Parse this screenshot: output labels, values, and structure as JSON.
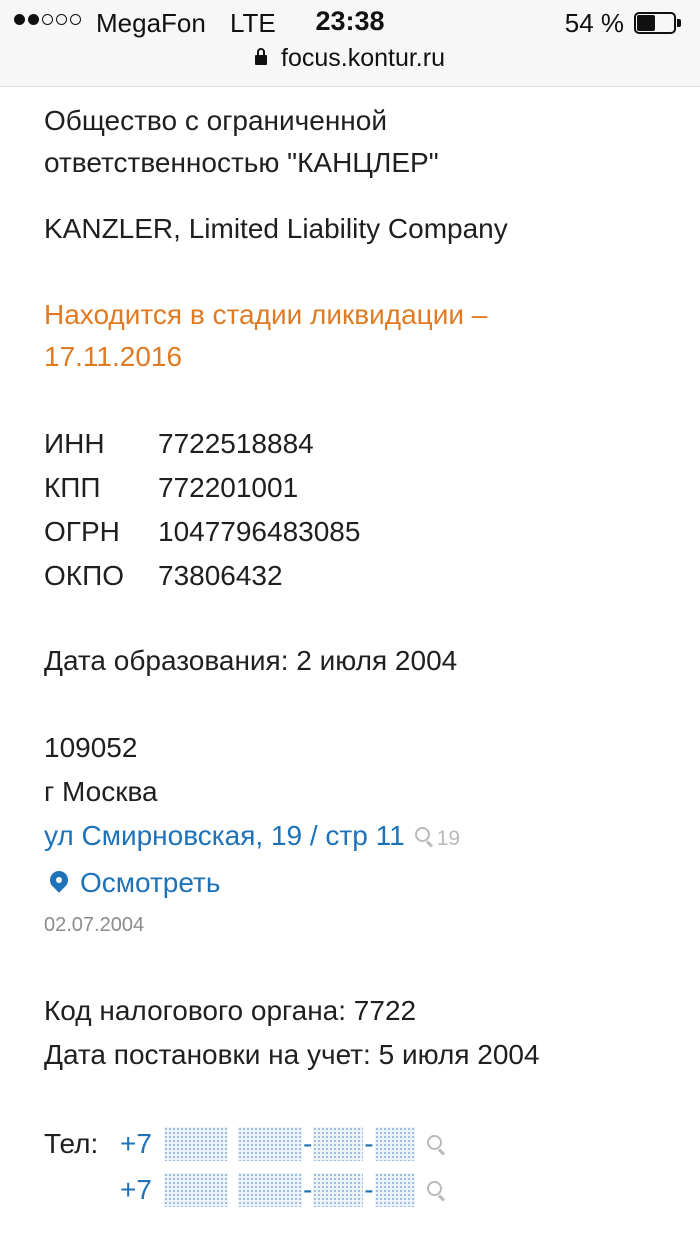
{
  "status_bar": {
    "carrier": "MegaFon",
    "network": "LTE",
    "time": "23:38",
    "battery_percent_text": "54 %",
    "battery_level": 0.54,
    "signal_strength": 2,
    "signal_max": 5
  },
  "url_bar": {
    "domain": "focus.kontur.ru",
    "lock_icon": "lock-icon"
  },
  "company": {
    "name_ru": "Общество с ограниченной ответственностью \"КАНЦЛЕР\"",
    "name_en": "KANZLER, Limited Liability Company",
    "status": "Находится в стадии ликвидации – 17.11.2016"
  },
  "codes": [
    {
      "label": "ИНН",
      "value": "7722518884"
    },
    {
      "label": "КПП",
      "value": "772201001"
    },
    {
      "label": "ОГРН",
      "value": "1047796483085"
    },
    {
      "label": "ОКПО",
      "value": "73806432"
    }
  ],
  "founded": "Дата образования: 2 июля 2004",
  "address": {
    "postcode": "109052",
    "city": "г Москва",
    "street_link": "ул Смирновская, 19 / стр 11",
    "search_count": "19",
    "view_link": "Осмотреть",
    "date": "02.07.2004"
  },
  "tax": {
    "office_code": "Код налогового органа: 7722",
    "registration_date": "Дата постановки на учет: 5 июля 2004"
  },
  "phones": {
    "label": "Тел:",
    "items": [
      {
        "prefix": "+7",
        "sep1": "-",
        "sep2": "-"
      },
      {
        "prefix": "+7",
        "sep1": "-",
        "sep2": "-"
      }
    ]
  },
  "colors": {
    "accent_link": "#1e72b8",
    "status_orange": "#e07b24",
    "muted": "#8c8c8c"
  }
}
